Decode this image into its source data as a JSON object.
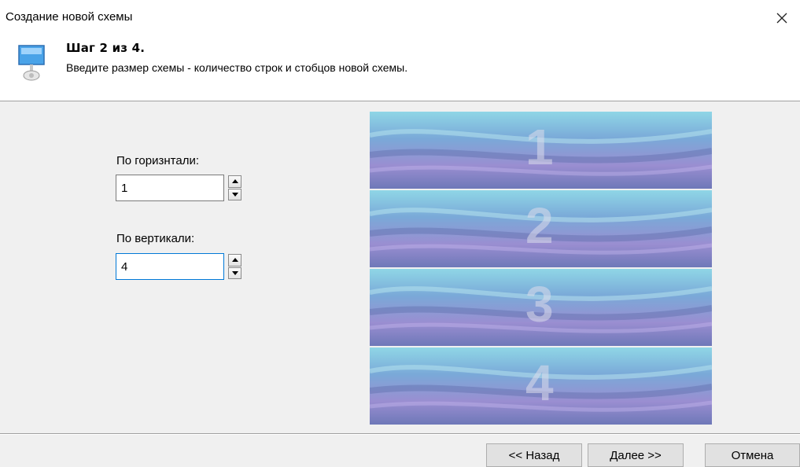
{
  "window": {
    "title": "Создание новой схемы"
  },
  "header": {
    "step_title": "Шаг 2 из 4.",
    "description": "Введите размер схемы - количество строк и стобцов новой схемы."
  },
  "form": {
    "horizontal_label": "По горизнтали:",
    "horizontal_value": "1",
    "vertical_label": "По вертикали:",
    "vertical_value": "4"
  },
  "preview": {
    "panes": [
      "1",
      "2",
      "3",
      "4"
    ]
  },
  "buttons": {
    "back": "<< Назад",
    "next": "Далее >>",
    "cancel": "Отмена"
  }
}
